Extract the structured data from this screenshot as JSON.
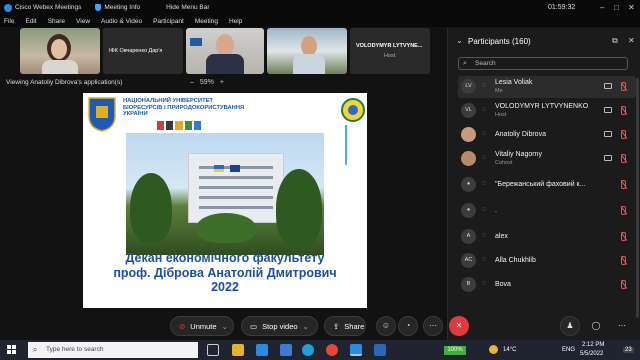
{
  "titlebar": {
    "app_title": "Cisco Webex Meetings",
    "meeting_info": "Meeting Info",
    "hide_menu": "Hide Menu Bar",
    "timer": "01:59:32",
    "controls": [
      "–",
      "□",
      "✕"
    ]
  },
  "menubar": [
    "File",
    "Edit",
    "Share",
    "View",
    "Audio & Video",
    "Participant",
    "Meeting",
    "Help"
  ],
  "videos": [
    {
      "name": ""
    },
    {
      "name": "ІФК Овчаренко Дар'я"
    },
    {
      "name": ""
    },
    {
      "name": ""
    },
    {
      "name": "VOLODYMYR LYTVYNE...",
      "role": "Host"
    }
  ],
  "viewing": "Viewing Anatoliy Dibrova's application(s)",
  "zoom": {
    "minus": "–",
    "value": "59%",
    "plus": "+"
  },
  "slide": {
    "university": [
      "НАЦІОНАЛЬНИЙ УНІВЕРСИТЕТ",
      "БІОРЕСУРСІВ І ПРИРОДОКОРИСТУВАННЯ",
      "УКРАЇНИ"
    ],
    "title_lines": [
      "Декан економічного факультету",
      "проф. Діброва Анатолій Дмитрович",
      "2022"
    ]
  },
  "panel": {
    "title": "Participants (160)",
    "search_placeholder": "Search",
    "participants": [
      {
        "initials": "LV",
        "name": "Lesia Voliak",
        "sub": "Me",
        "cam": true
      },
      {
        "initials": "VL",
        "name": "VOLODYMYR LYTVYNENKO",
        "sub": "Host",
        "cam": true
      },
      {
        "initials": "",
        "name": "Anatoliy Dibrova",
        "sub": "",
        "cam": true
      },
      {
        "initials": "",
        "name": "Vitaliy Nagorny",
        "sub": "Cohost",
        "cam": true
      },
      {
        "initials": "",
        "name": "\"Бережанський фаховий к...",
        "sub": "",
        "cam": false
      },
      {
        "initials": "",
        "name": ".",
        "sub": "",
        "cam": false
      },
      {
        "initials": "A",
        "name": "alex",
        "sub": "",
        "cam": false
      },
      {
        "initials": "AC",
        "name": "Alla Chukhlib",
        "sub": "",
        "cam": false
      },
      {
        "initials": "B",
        "name": "Bova",
        "sub": "",
        "cam": false
      }
    ]
  },
  "controls": {
    "unmute": "Unmute",
    "stop_video": "Stop video",
    "share": "Share"
  },
  "taskbar": {
    "search_placeholder": "Type here to search",
    "battery": "100%",
    "temperature": "14°C",
    "language": "ENG",
    "time": "2:12 PM",
    "date": "5/5/2022",
    "notifications": "23"
  },
  "colors": {
    "accent": "#2a8be0",
    "danger": "#e0393e",
    "panel": "#1b1b1b"
  }
}
